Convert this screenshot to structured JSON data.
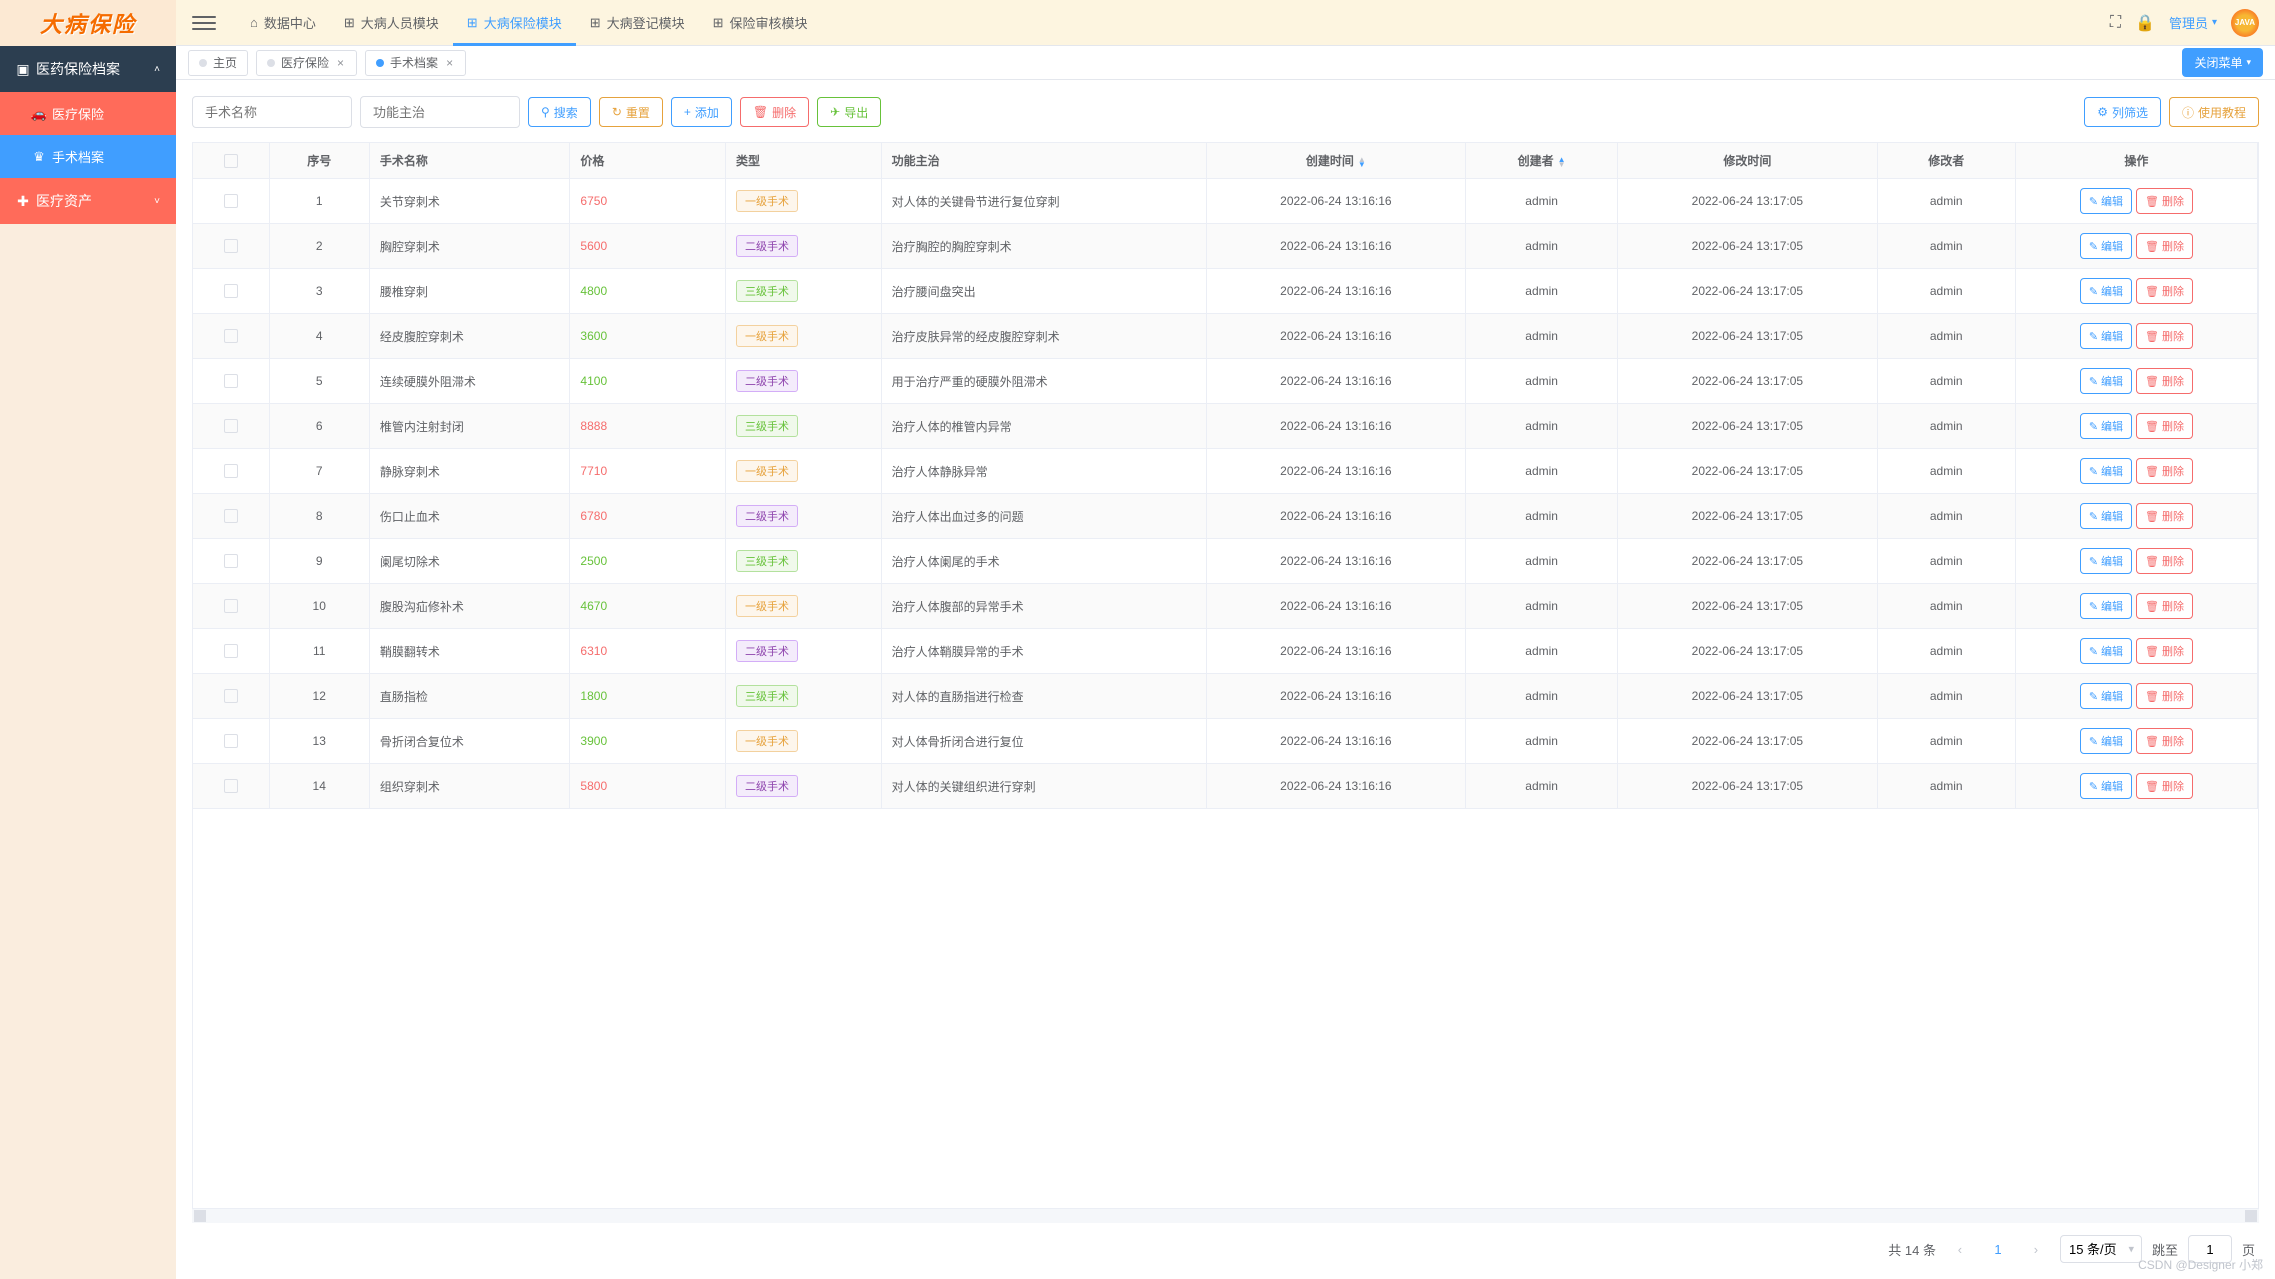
{
  "brand": "大病保险",
  "header": {
    "nav": [
      {
        "label": "数据中心",
        "icon": "home"
      },
      {
        "label": "大病人员模块",
        "icon": "grid"
      },
      {
        "label": "大病保险模块",
        "icon": "grid",
        "active": true
      },
      {
        "label": "大病登记模块",
        "icon": "grid"
      },
      {
        "label": "保险审核模块",
        "icon": "grid"
      }
    ],
    "admin": "管理员",
    "avatar_text": "JAVA"
  },
  "sidebar": {
    "group1": "医药保险档案",
    "item_medical": "医疗保险",
    "item_surgery": "手术档案",
    "group2": "医疗资产"
  },
  "tabs": [
    {
      "label": "主页",
      "closable": false
    },
    {
      "label": "医疗保险",
      "closable": true
    },
    {
      "label": "手术档案",
      "closable": true,
      "active": true
    }
  ],
  "close_menu": "关闭菜单",
  "toolbar": {
    "search_ph": "手术名称",
    "func_ph": "功能主治",
    "search": "搜索",
    "reset": "重置",
    "add": "添加",
    "delete": "删除",
    "export": "导出",
    "filter": "列筛选",
    "tutorial": "使用教程"
  },
  "table": {
    "headers": {
      "idx": "序号",
      "name": "手术名称",
      "price": "价格",
      "type": "类型",
      "func": "功能主治",
      "ctime": "创建时间",
      "creator": "创建者",
      "mtime": "修改时间",
      "modifier": "修改者",
      "ops": "操作"
    },
    "type_labels": {
      "1": "一级手术",
      "2": "二级手术",
      "3": "三级手术"
    },
    "op_edit": "编辑",
    "op_delete": "删除",
    "rows": [
      {
        "idx": 1,
        "name": "关节穿刺术",
        "price": 6750,
        "pc": 1,
        "type": 1,
        "func": "对人体的关键骨节进行复位穿刺",
        "ctime": "2022-06-24 13:16:16",
        "creator": "admin",
        "mtime": "2022-06-24 13:17:05",
        "modifier": "admin"
      },
      {
        "idx": 2,
        "name": "胸腔穿刺术",
        "price": 5600,
        "pc": 1,
        "type": 2,
        "func": "治疗胸腔的胸腔穿刺术",
        "ctime": "2022-06-24 13:16:16",
        "creator": "admin",
        "mtime": "2022-06-24 13:17:05",
        "modifier": "admin"
      },
      {
        "idx": 3,
        "name": "腰椎穿刺",
        "price": 4800,
        "pc": 2,
        "type": 3,
        "func": "治疗腰间盘突出",
        "ctime": "2022-06-24 13:16:16",
        "creator": "admin",
        "mtime": "2022-06-24 13:17:05",
        "modifier": "admin"
      },
      {
        "idx": 4,
        "name": "经皮腹腔穿刺术",
        "price": 3600,
        "pc": 2,
        "type": 1,
        "func": "治疗皮肤异常的经皮腹腔穿刺术",
        "ctime": "2022-06-24 13:16:16",
        "creator": "admin",
        "mtime": "2022-06-24 13:17:05",
        "modifier": "admin"
      },
      {
        "idx": 5,
        "name": "连续硬膜外阻滞术",
        "price": 4100,
        "pc": 2,
        "type": 2,
        "func": "用于治疗严重的硬膜外阻滞术",
        "ctime": "2022-06-24 13:16:16",
        "creator": "admin",
        "mtime": "2022-06-24 13:17:05",
        "modifier": "admin"
      },
      {
        "idx": 6,
        "name": "椎管内注射封闭",
        "price": 8888,
        "pc": 1,
        "type": 3,
        "func": "治疗人体的椎管内异常",
        "ctime": "2022-06-24 13:16:16",
        "creator": "admin",
        "mtime": "2022-06-24 13:17:05",
        "modifier": "admin"
      },
      {
        "idx": 7,
        "name": "静脉穿刺术",
        "price": 7710,
        "pc": 1,
        "type": 1,
        "func": "治疗人体静脉异常",
        "ctime": "2022-06-24 13:16:16",
        "creator": "admin",
        "mtime": "2022-06-24 13:17:05",
        "modifier": "admin"
      },
      {
        "idx": 8,
        "name": "伤口止血术",
        "price": 6780,
        "pc": 1,
        "type": 2,
        "func": "治疗人体出血过多的问题",
        "ctime": "2022-06-24 13:16:16",
        "creator": "admin",
        "mtime": "2022-06-24 13:17:05",
        "modifier": "admin"
      },
      {
        "idx": 9,
        "name": "阑尾切除术",
        "price": 2500,
        "pc": 2,
        "type": 3,
        "func": "治疗人体阑尾的手术",
        "ctime": "2022-06-24 13:16:16",
        "creator": "admin",
        "mtime": "2022-06-24 13:17:05",
        "modifier": "admin"
      },
      {
        "idx": 10,
        "name": "腹股沟疝修补术",
        "price": 4670,
        "pc": 2,
        "type": 1,
        "func": "治疗人体腹部的异常手术",
        "ctime": "2022-06-24 13:16:16",
        "creator": "admin",
        "mtime": "2022-06-24 13:17:05",
        "modifier": "admin"
      },
      {
        "idx": 11,
        "name": "鞘膜翻转术",
        "price": 6310,
        "pc": 1,
        "type": 2,
        "func": "治疗人体鞘膜异常的手术",
        "ctime": "2022-06-24 13:16:16",
        "creator": "admin",
        "mtime": "2022-06-24 13:17:05",
        "modifier": "admin"
      },
      {
        "idx": 12,
        "name": "直肠指检",
        "price": 1800,
        "pc": 2,
        "type": 3,
        "func": "对人体的直肠指进行检查",
        "ctime": "2022-06-24 13:16:16",
        "creator": "admin",
        "mtime": "2022-06-24 13:17:05",
        "modifier": "admin"
      },
      {
        "idx": 13,
        "name": "骨折闭合复位术",
        "price": 3900,
        "pc": 2,
        "type": 1,
        "func": "对人体骨折闭合进行复位",
        "ctime": "2022-06-24 13:16:16",
        "creator": "admin",
        "mtime": "2022-06-24 13:17:05",
        "modifier": "admin"
      },
      {
        "idx": 14,
        "name": "组织穿刺术",
        "price": 5800,
        "pc": 1,
        "type": 2,
        "func": "对人体的关键组织进行穿刺",
        "ctime": "2022-06-24 13:16:16",
        "creator": "admin",
        "mtime": "2022-06-24 13:17:05",
        "modifier": "admin"
      }
    ]
  },
  "pagination": {
    "total_label": "共 14 条",
    "current": "1",
    "size": "15 条/页",
    "jump": "跳至",
    "jump_val": "1",
    "page_suffix": "页"
  },
  "watermark": "CSDN @Designer 小郑"
}
